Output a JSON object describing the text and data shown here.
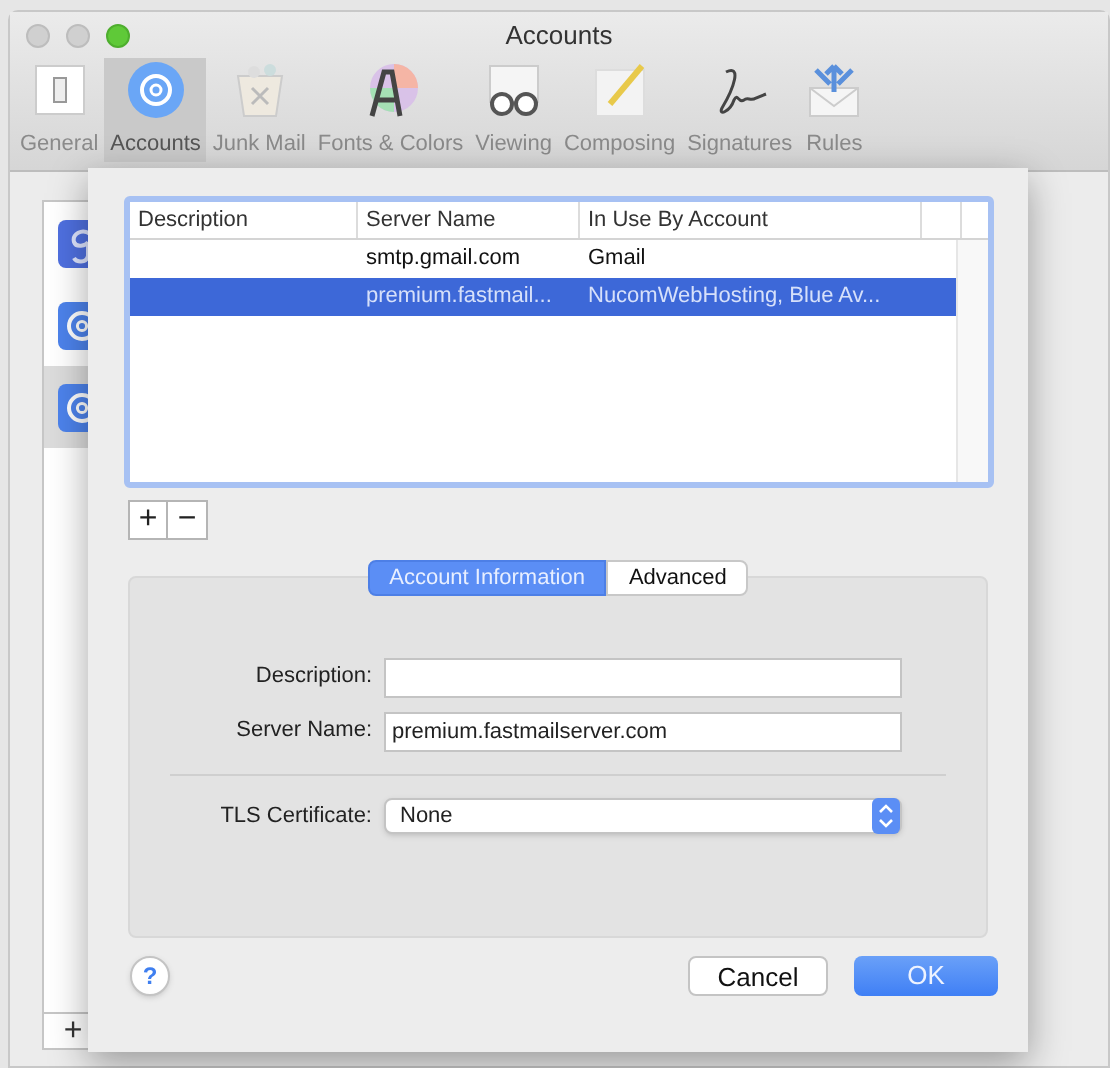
{
  "window": {
    "title": "Accounts"
  },
  "toolbar": {
    "items": [
      {
        "kind": "general",
        "label": "General",
        "selected": false
      },
      {
        "kind": "accounts",
        "label": "Accounts",
        "selected": true
      },
      {
        "kind": "junk",
        "label": "Junk Mail",
        "selected": false
      },
      {
        "kind": "fonts",
        "label": "Fonts & Colors",
        "selected": false
      },
      {
        "kind": "viewing",
        "label": "Viewing",
        "selected": false
      },
      {
        "kind": "composing",
        "label": "Composing",
        "selected": false
      },
      {
        "kind": "signatures",
        "label": "Signatures",
        "selected": false
      },
      {
        "kind": "rules",
        "label": "Rules",
        "selected": false
      }
    ]
  },
  "accounts_list": {
    "items": [
      {
        "kind": "google",
        "selected": false
      },
      {
        "kind": "mail",
        "selected": false
      },
      {
        "kind": "mail",
        "selected": true
      }
    ],
    "add_button": "+"
  },
  "sheet": {
    "table": {
      "columns": [
        "Description",
        "Server Name",
        "In Use By Account"
      ],
      "rows": [
        {
          "cells": [
            "",
            "smtp.gmail.com",
            "Gmail"
          ],
          "selected": false
        },
        {
          "cells": [
            "",
            "premium.fastmail...",
            "NucomWebHosting, Blue Av..."
          ],
          "selected": true
        }
      ]
    },
    "add_button": "+",
    "remove_button": "−",
    "tabs": [
      {
        "label": "Account Information",
        "selected": true
      },
      {
        "label": "Advanced",
        "selected": false
      }
    ],
    "fields": [
      {
        "label": "Description:"
      },
      {
        "label": "Server Name:",
        "value": "premium.fastmailserver.com"
      }
    ],
    "tls": {
      "label": "TLS Certificate:",
      "value": "None"
    },
    "help_button": "?",
    "buttons": [
      {
        "label": "Cancel",
        "kind": "secondary"
      },
      {
        "label": "OK",
        "kind": "primary"
      }
    ]
  }
}
